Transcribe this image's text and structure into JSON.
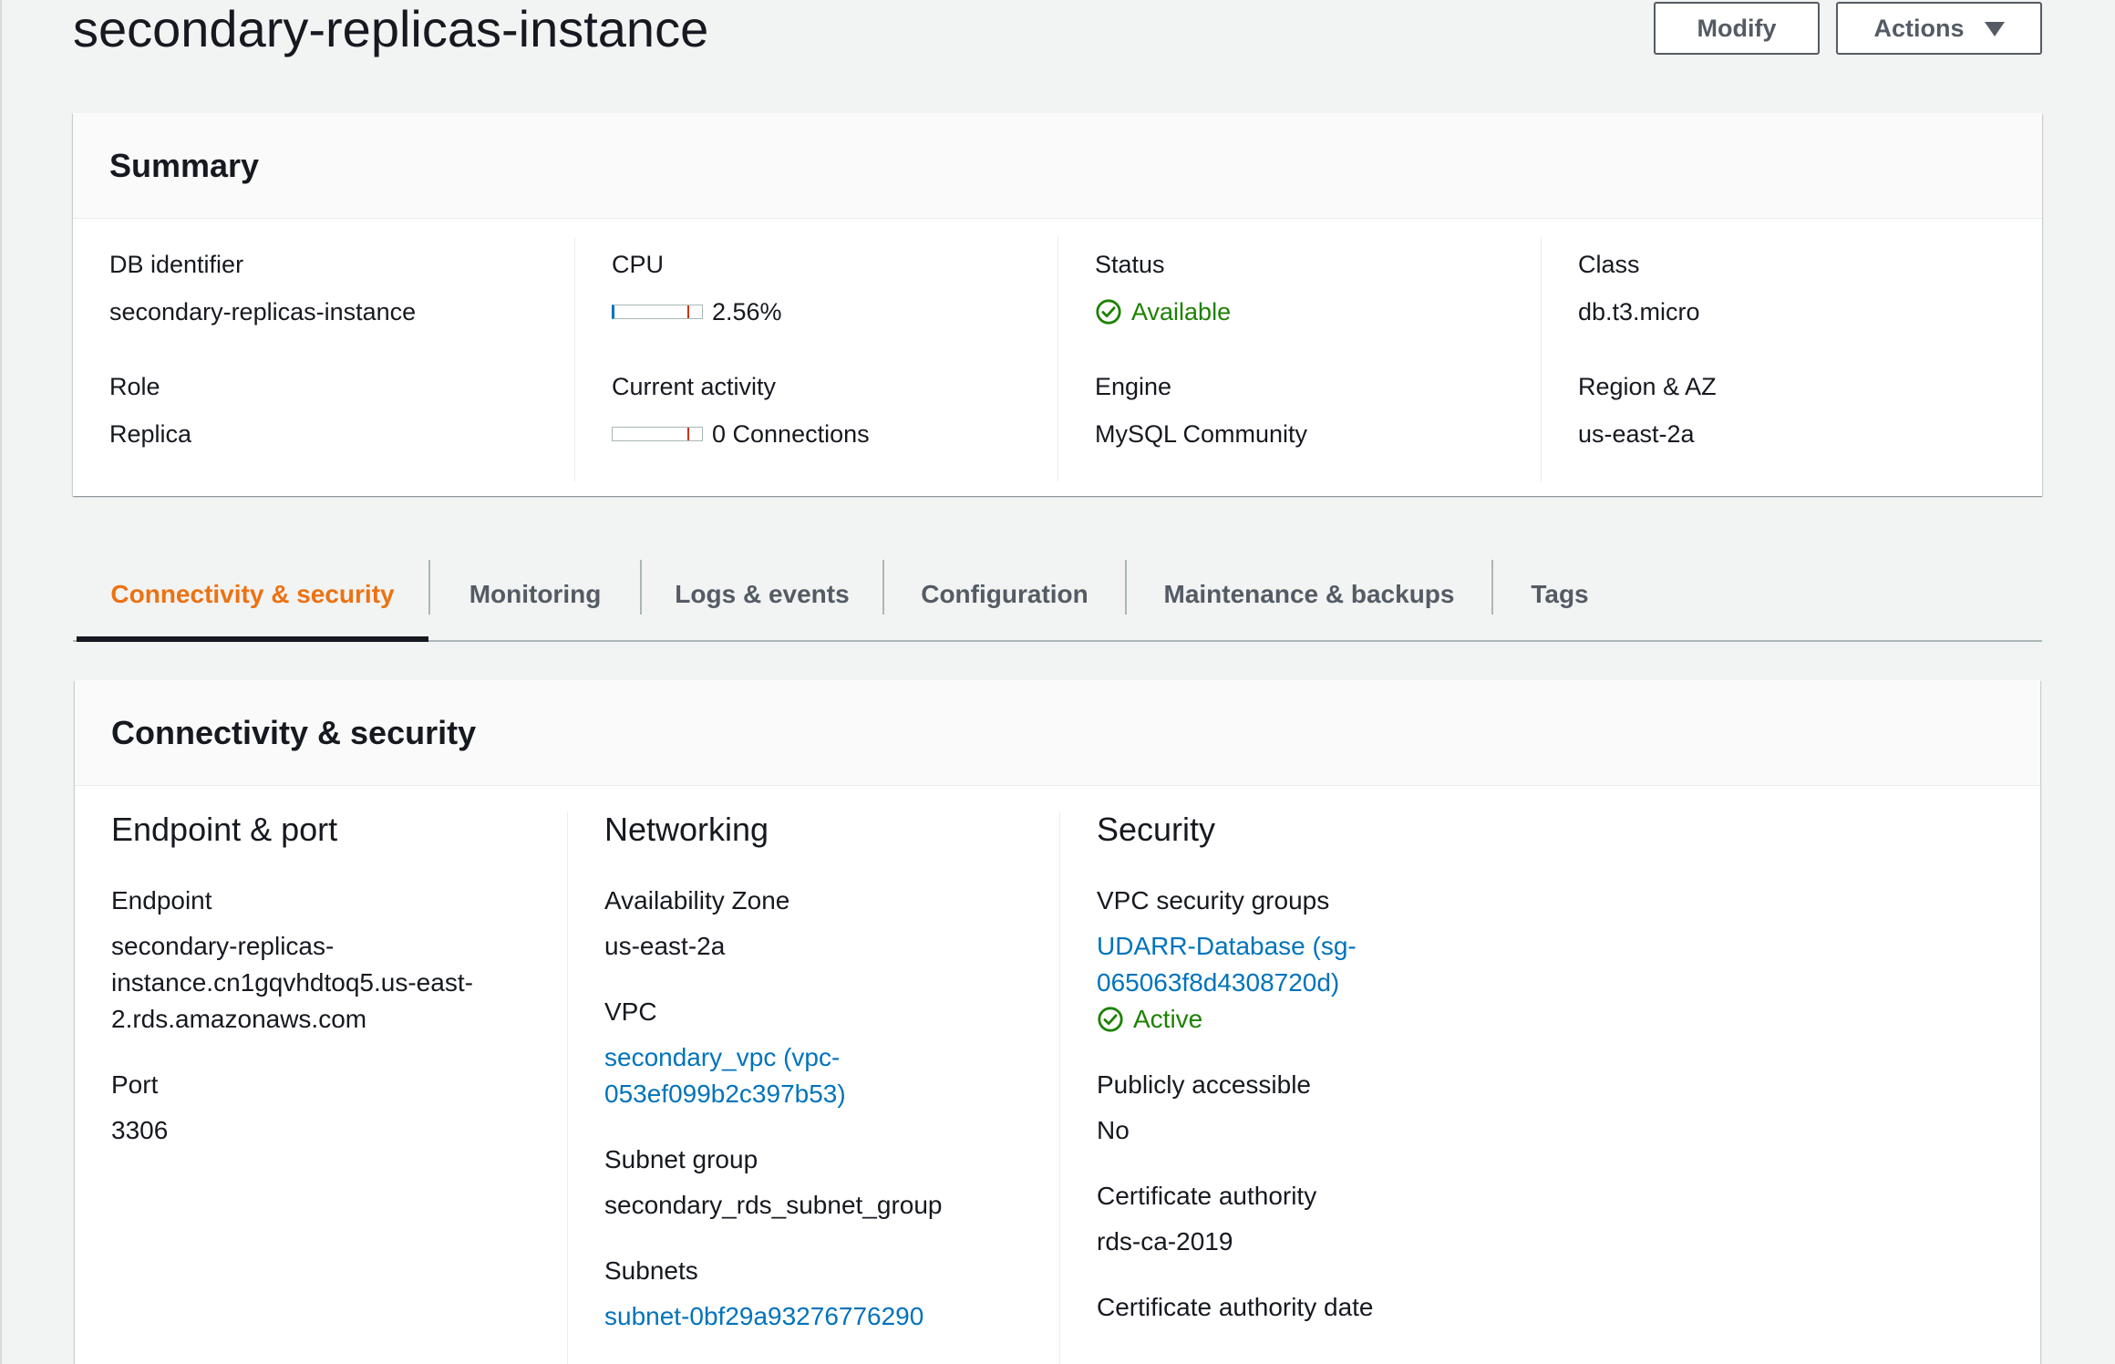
{
  "header": {
    "title": "secondary-replicas-instance",
    "modify_label": "Modify",
    "actions_label": "Actions"
  },
  "summary": {
    "title": "Summary",
    "db_identifier_label": "DB identifier",
    "db_identifier_value": "secondary-replicas-instance",
    "role_label": "Role",
    "role_value": "Replica",
    "cpu_label": "CPU",
    "cpu_value": "2.56%",
    "cpu_fraction": 0.0256,
    "activity_label": "Current activity",
    "activity_value": "0 Connections",
    "activity_fraction": 0,
    "status_label": "Status",
    "status_value": "Available",
    "engine_label": "Engine",
    "engine_value": "MySQL Community",
    "class_label": "Class",
    "class_value": "db.t3.micro",
    "region_label": "Region & AZ",
    "region_value": "us-east-2a"
  },
  "tabs": [
    {
      "label": "Connectivity & security",
      "active": true
    },
    {
      "label": "Monitoring"
    },
    {
      "label": "Logs & events"
    },
    {
      "label": "Configuration"
    },
    {
      "label": "Maintenance & backups"
    },
    {
      "label": "Tags"
    }
  ],
  "connectivity": {
    "title": "Connectivity & security",
    "endpoint_port": {
      "heading": "Endpoint & port",
      "endpoint_label": "Endpoint",
      "endpoint_value": "secondary-replicas-\ninstance.cn1gqvhdtoq5.us-east-\n2.rds.amazonaws.com",
      "port_label": "Port",
      "port_value": "3306"
    },
    "networking": {
      "heading": "Networking",
      "az_label": "Availability Zone",
      "az_value": "us-east-2a",
      "vpc_label": "VPC",
      "vpc_value": "secondary_vpc (vpc-\n053ef099b2c397b53)",
      "subnet_group_label": "Subnet group",
      "subnet_group_value": "secondary_rds_subnet_group",
      "subnets_label": "Subnets",
      "subnets_value": "subnet-0bf29a93276776290"
    },
    "security": {
      "heading": "Security",
      "sg_label": "VPC security groups",
      "sg_value": "UDARR-Database (sg-\n065063f8d4308720d)",
      "sg_status": "Active",
      "public_label": "Publicly accessible",
      "public_value": "No",
      "ca_label": "Certificate authority",
      "ca_value": "rds-ca-2019",
      "ca_date_label": "Certificate authority date"
    }
  },
  "colors": {
    "accent_orange": "#ec7211",
    "link_blue": "#0073bb",
    "success_green": "#1d8102"
  }
}
